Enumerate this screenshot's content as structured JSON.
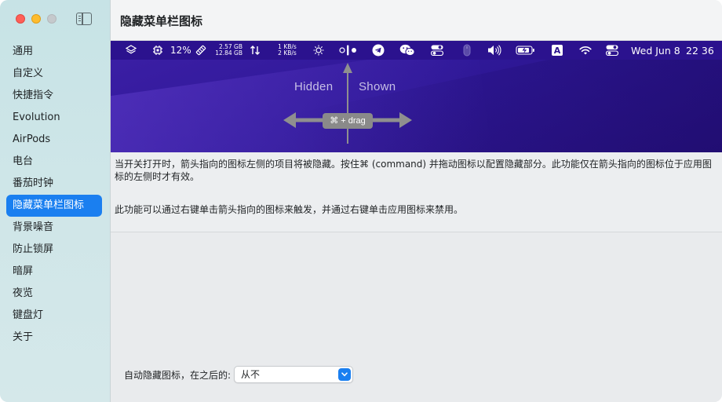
{
  "window": {
    "title": "隐藏菜单栏图标"
  },
  "sidebar": {
    "items": [
      {
        "label": "通用"
      },
      {
        "label": "自定义"
      },
      {
        "label": "快捷指令"
      },
      {
        "label": "Evolution"
      },
      {
        "label": "AirPods"
      },
      {
        "label": "电台"
      },
      {
        "label": "番茄时钟"
      },
      {
        "label": "隐藏菜单栏图标"
      },
      {
        "label": "背景噪音"
      },
      {
        "label": "防止锁屏"
      },
      {
        "label": "暗屏"
      },
      {
        "label": "夜览"
      },
      {
        "label": "键盘灯"
      },
      {
        "label": "关于"
      }
    ],
    "active_index": 7
  },
  "menubar": {
    "cpu_percent": "12%",
    "mem_top": "2.57 GB",
    "mem_bottom": "12.84 GB",
    "net_up": "1 KB/s",
    "net_down": "2 KB/s",
    "input_letter": "A",
    "date": "Wed Jun 8",
    "time": "22 36"
  },
  "diagram": {
    "hidden_label": "Hidden",
    "shown_label": "Shown",
    "drag_label": "⌘ + drag"
  },
  "description": {
    "paragraph1": "当开关打开时，箭头指向的图标左侧的项目将被隐藏。按住⌘ (command) 并拖动图标以配置隐藏部分。此功能仅在箭头指向的图标位于应用图标的左侧时才有效。",
    "paragraph2": "此功能可以通过右键单击箭头指向的图标来触发，并通过右键单击应用图标来禁用。"
  },
  "autohide": {
    "label": "自动隐藏图标，在之后的:",
    "selected": "从不"
  },
  "colors": {
    "accent": "#1a7ff0",
    "banner": "#2f1898"
  }
}
